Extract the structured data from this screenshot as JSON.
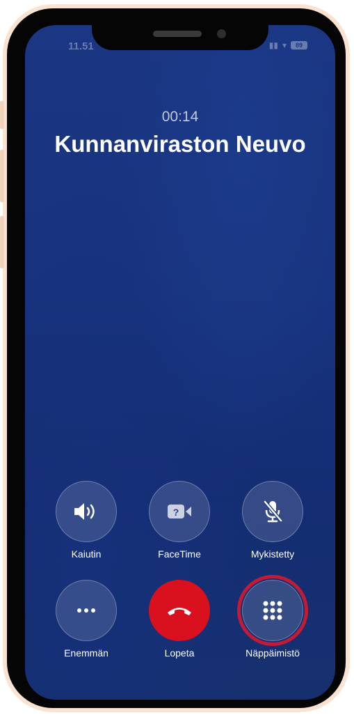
{
  "status_bar": {
    "time": "11.51",
    "battery": "89"
  },
  "call": {
    "timer": "00:14",
    "caller_name": "Kunnanviraston Neuvo"
  },
  "controls": {
    "speaker": {
      "label": "Kaiutin",
      "icon": "speaker-icon"
    },
    "facetime": {
      "label": "FaceTime",
      "icon": "facetime-icon"
    },
    "mute": {
      "label": "Mykistetty",
      "icon": "mic-muted-icon"
    },
    "more": {
      "label": "Enemmän",
      "icon": "more-icon"
    },
    "end_call": {
      "label": "Lopeta",
      "icon": "end-call-icon"
    },
    "keypad": {
      "label": "Näppäimistö",
      "icon": "keypad-icon"
    }
  },
  "colors": {
    "end_call": "#d9101e",
    "highlight_ring": "#c31b35",
    "background": "#18347e"
  }
}
